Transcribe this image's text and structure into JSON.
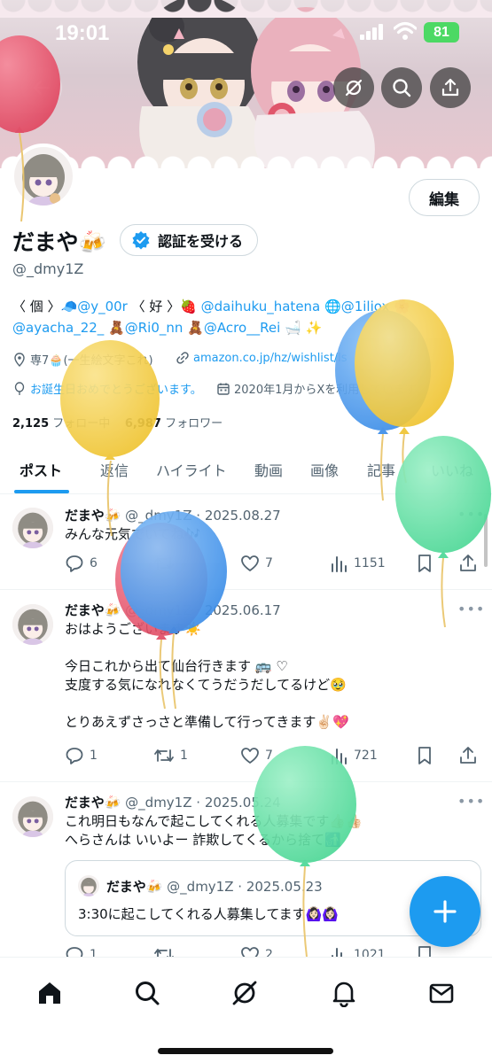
{
  "status_bar": {
    "time": "19:01",
    "battery": "81"
  },
  "profile": {
    "name": "だまや🍻",
    "handle": "@_dmy1Z",
    "edit_label": "編集",
    "verify_label": "認証を受ける",
    "bio_line1": {
      "prefix": "〈 個 〉🧢",
      "link1": "@y_00r",
      "mid": " 〈 好 〉🍓 ",
      "link2": "@daihuku_hatena",
      "mid2": " 🌐",
      "link3": "@1iliox",
      "suffix": " 🌸"
    },
    "bio_line2": {
      "link1": "@ayacha_22_",
      "mid1": " 🧸",
      "link2": "@Ri0_nn",
      "mid2": " 🧸",
      "link3": "@Acro__Rei",
      "suffix": " 🛁 ✨"
    },
    "location": "専7🧁(一生絵文字これ)",
    "website": "amazon.co.jp/hz/wishlist/ls",
    "birthday": "お誕生日おめでとうございます。",
    "joined": "2020年1月からXを利用しています",
    "following_count": "2,125",
    "following_label": "フォロー中",
    "followers_count": "6,987",
    "followers_label": "フォロワー"
  },
  "tabs": [
    "ポスト",
    "返信",
    "ハイライト",
    "動画",
    "画像",
    "記事",
    "いいね"
  ],
  "posts": [
    {
      "name": "だまや🍻",
      "handle": "@_dmy1Z",
      "date": "2025.08.27",
      "text": "みんな元気でいてね🎶",
      "replies": "6",
      "reposts": "",
      "likes": "7",
      "views": "1151"
    },
    {
      "name": "だまや🍻",
      "handle": "@_dmy1Z",
      "date": "2025.06.17",
      "text": "おはようございます☀️\n\n今日これから出て仙台行きます 🚌 ♡\n支度する気になれなくてうだうだしてるけど🥹\n\nとりあえずさっさと準備して行ってきます✌🏻💖",
      "replies": "1",
      "reposts": "1",
      "likes": "7",
      "views": "721"
    },
    {
      "name": "だまや🍻",
      "handle": "@_dmy1Z",
      "date": "2025.05.24",
      "text": "これ明日もなんで起こしてくれる人募集です👍🏻👍🏻\nへらさんは いいよー 詐欺してくるから捨て🚮",
      "replies": "1",
      "reposts": "",
      "likes": "2",
      "views": "1021",
      "quote": {
        "name": "だまや🍻",
        "handle": "@_dmy1Z",
        "date": "2025.05.23",
        "text": "3:30に起こしてくれる人募集してます🙆🏻‍♀️🙆🏻‍♀️"
      }
    }
  ],
  "icons": {
    "back": "back-arrow-icon",
    "grok": "grok-icon",
    "search": "search-icon",
    "share": "share-icon",
    "verified": "verified-badge-icon",
    "location": "location-pin-icon",
    "link": "link-icon",
    "birthday": "balloon-icon",
    "calendar": "calendar-icon",
    "reply": "reply-icon",
    "repost": "repost-icon",
    "like": "heart-icon",
    "views": "views-icon",
    "bookmark": "bookmark-icon",
    "compose": "plus-icon",
    "home": "home-icon",
    "notifications": "bell-icon",
    "messages": "mail-icon"
  },
  "colors": {
    "accent": "#1d9bf0",
    "text": "#0f1419",
    "muted": "#536471",
    "balloon_red": "#e8566e",
    "balloon_blue": "#4a9ef0",
    "balloon_yellow": "#f3cf45",
    "balloon_green": "#5fe0a6"
  }
}
